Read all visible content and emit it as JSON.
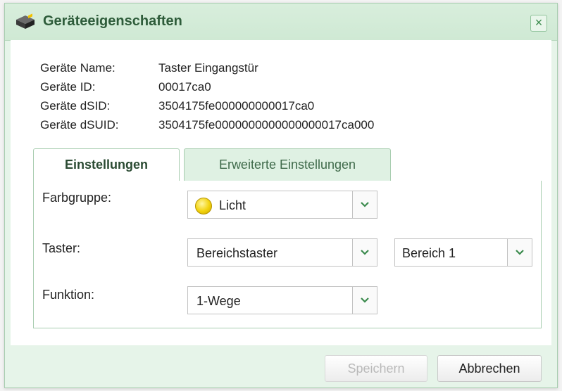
{
  "dialog": {
    "title": "Geräteeigenschaften",
    "close_label": "×"
  },
  "device_info": [
    {
      "label": "Geräte Name:",
      "value": "Taster Eingangstür"
    },
    {
      "label": "Geräte ID:",
      "value": "00017ca0"
    },
    {
      "label": "Geräte dSID:",
      "value": "3504175fe000000000017ca0"
    },
    {
      "label": "Geräte dSUID:",
      "value": "3504175fe0000000000000000017ca000"
    }
  ],
  "tabs": [
    {
      "label": "Einstellungen",
      "active": true
    },
    {
      "label": "Erweiterte Einstellungen",
      "active": false
    }
  ],
  "settings": {
    "farbgruppe_label": "Farbgruppe:",
    "farbgruppe_value": "Licht",
    "farbgruppe_color": "#f2d20c",
    "taster_label": "Taster:",
    "taster_value": "Bereichstaster",
    "bereich_value": "Bereich 1",
    "funktion_label": "Funktion:",
    "funktion_value": "1-Wege"
  },
  "buttons": {
    "save": "Speichern",
    "cancel": "Abbrechen"
  },
  "icons": {
    "app": "device-icon",
    "dropdown": "chevron-down-icon"
  }
}
